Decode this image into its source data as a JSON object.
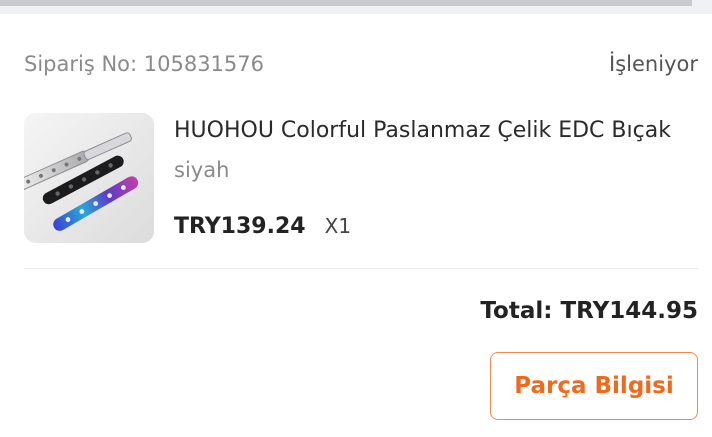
{
  "order": {
    "number_text": "Sipariş No: 105831576",
    "status": "İşleniyor"
  },
  "item": {
    "image_icon": "butterfly-knife-product-image",
    "title": "HUOHOU Colorful Paslanmaz Çelik EDC Bıçak",
    "variant": "siyah",
    "price": "TRY139.24",
    "quantity": "X1"
  },
  "summary": {
    "total": "Total: TRY144.95"
  },
  "actions": {
    "parts_info_label": "Parça Bilgisi"
  },
  "colors": {
    "accent": "#ee6a1f",
    "accent_border": "#f08a4b"
  }
}
